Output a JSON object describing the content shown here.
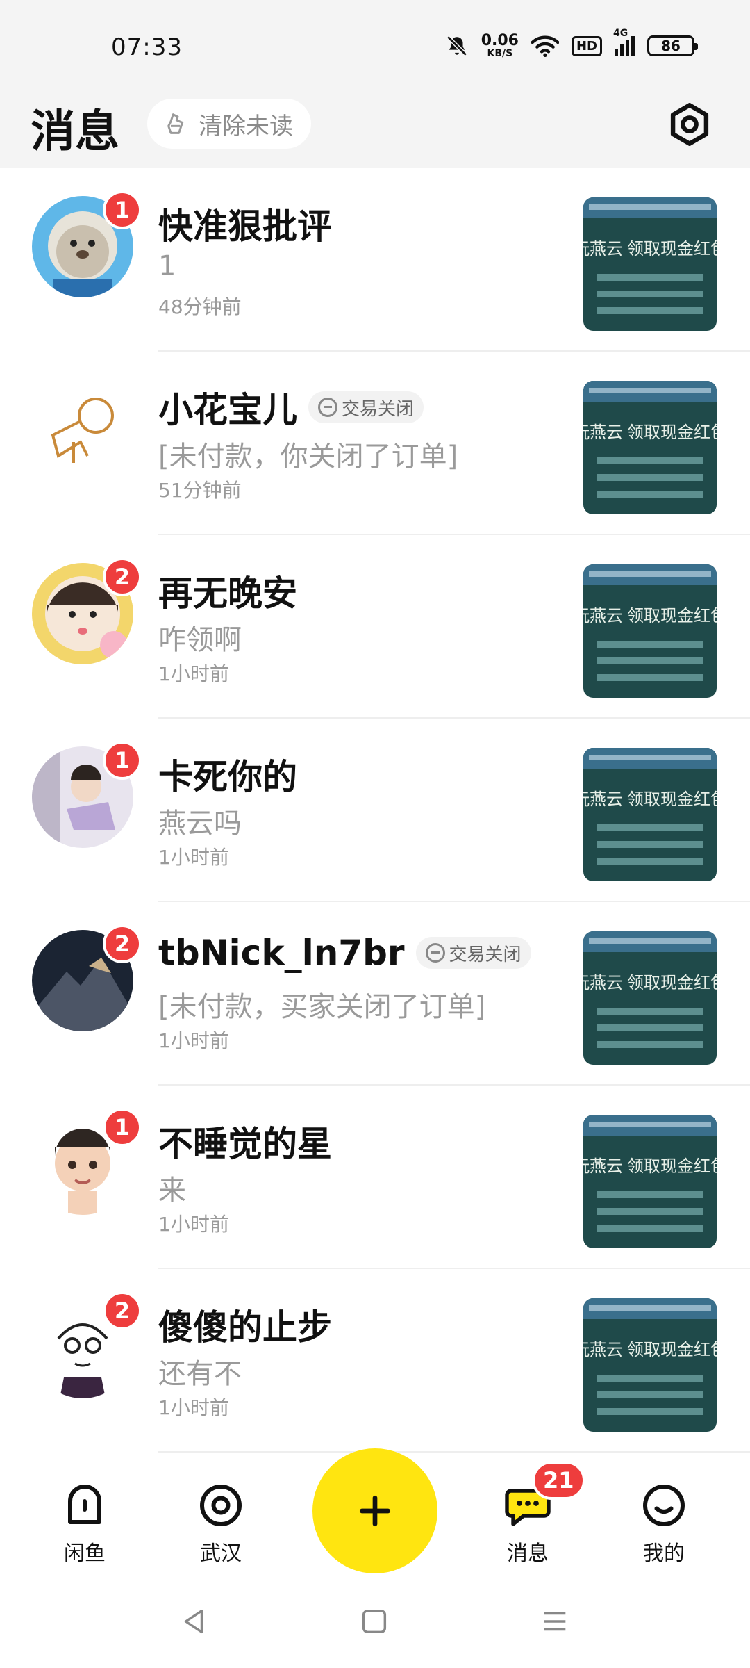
{
  "status_bar": {
    "time": "07:33",
    "net_speed_value": "0.06",
    "net_speed_unit": "KB/S",
    "hd_label": "HD",
    "network_label": "4G",
    "battery": "86"
  },
  "header": {
    "title": "消息",
    "clear_unread_label": "清除未读"
  },
  "messages": [
    {
      "name": "快准狠批评",
      "badge": "1",
      "tag": "",
      "preview": "1",
      "time": "48分钟前",
      "avatar": "seal-avatar"
    },
    {
      "name": "小花宝儿",
      "badge": "",
      "tag": "交易关闭",
      "preview": "[未付款，你关闭了订单]",
      "time": "51分钟前",
      "avatar": "sketch-avatar"
    },
    {
      "name": "再无晚安",
      "badge": "2",
      "tag": "",
      "preview": "咋领啊",
      "time": "1小时前",
      "avatar": "girl-avatar"
    },
    {
      "name": "卡死你的",
      "badge": "1",
      "tag": "",
      "preview": "燕云吗",
      "time": "1小时前",
      "avatar": "cartoon-avatar"
    },
    {
      "name": "tbNick_ln7br",
      "badge": "2",
      "tag": "交易关闭",
      "preview": "[未付款，买家关闭了订单]",
      "time": "1小时前",
      "avatar": "mountain-avatar"
    },
    {
      "name": "不睡觉的星",
      "badge": "1",
      "tag": "",
      "preview": "来",
      "time": "1小时前",
      "avatar": "boy-3d-avatar"
    },
    {
      "name": "傻傻的止步",
      "badge": "2",
      "tag": "",
      "preview": "还有不",
      "time": "1小时前",
      "avatar": "glasses-sketch-avatar"
    }
  ],
  "thumbnail_text": "玩燕云 领取现金红包",
  "bottom_nav": {
    "items": [
      {
        "label": "闲鱼",
        "icon": "home-icon"
      },
      {
        "label": "武汉",
        "icon": "location-icon"
      },
      {
        "label": "消息",
        "icon": "chat-icon",
        "badge": "21"
      },
      {
        "label": "我的",
        "icon": "smile-icon"
      }
    ],
    "fab_icon": "plus-icon"
  },
  "colors": {
    "accent": "#ffe510",
    "badge": "#ee3d3d",
    "header_bg": "#f4f4f4"
  }
}
